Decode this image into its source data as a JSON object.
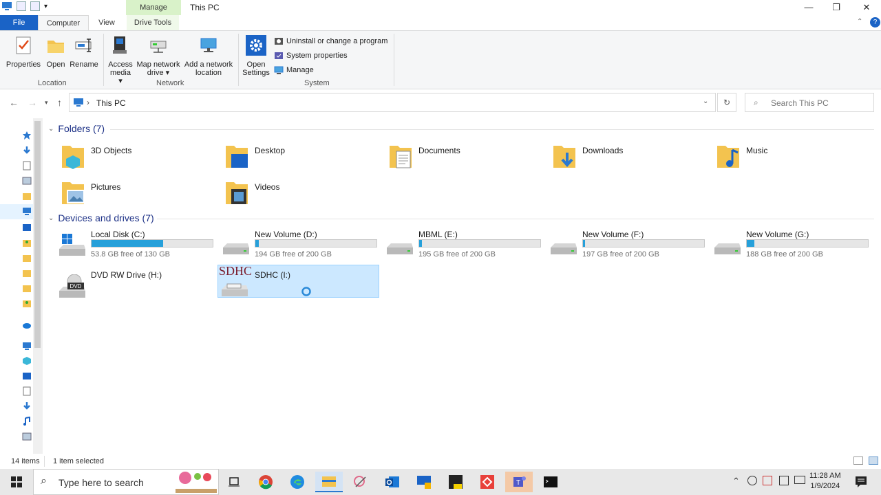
{
  "window": {
    "title": "This PC",
    "context_tab": "Manage",
    "controls": {
      "minimize": "—",
      "maximize": "❐",
      "close": "✕"
    }
  },
  "ribbon": {
    "tabs": [
      "File",
      "Computer",
      "View",
      "Drive Tools"
    ],
    "location_group": {
      "label": "Location",
      "buttons": [
        "Properties",
        "Open",
        "Rename"
      ]
    },
    "network_group": {
      "label": "Network",
      "access_media": [
        "Access",
        "media ▾"
      ],
      "map_network": [
        "Map network",
        "drive ▾"
      ],
      "add_network": [
        "Add a network",
        "location"
      ]
    },
    "system_group": {
      "label": "System",
      "open_settings": [
        "Open",
        "Settings"
      ],
      "items": [
        "Uninstall or change a program",
        "System properties",
        "Manage"
      ]
    }
  },
  "address": {
    "path": "This PC",
    "search_placeholder": "Search This PC"
  },
  "folders": {
    "header": "Folders (7)",
    "items": [
      "3D Objects",
      "Desktop",
      "Documents",
      "Downloads",
      "Music",
      "Pictures",
      "Videos"
    ]
  },
  "drives": {
    "header": "Devices and drives (7)",
    "items": [
      {
        "name": "Local Disk (C:)",
        "free": "53.8 GB free of 130 GB",
        "used_pct": 59
      },
      {
        "name": "New Volume (D:)",
        "free": "194 GB free of 200 GB",
        "used_pct": 3
      },
      {
        "name": "MBML (E:)",
        "free": "195 GB free of 200 GB",
        "used_pct": 2.5
      },
      {
        "name": "New Volume (F:)",
        "free": "197 GB free of 200 GB",
        "used_pct": 1.5
      },
      {
        "name": "New Volume (G:)",
        "free": "188 GB free of 200 GB",
        "used_pct": 6
      },
      {
        "name": "DVD RW Drive (H:)"
      },
      {
        "name": "SDHC (I:)",
        "badge": "SDHC"
      }
    ],
    "dvd_badge": "DVD"
  },
  "status": {
    "items": "14 items",
    "selected": "1 item selected"
  },
  "taskbar": {
    "search_placeholder": "Type here to search",
    "time": "11:28 AM",
    "date": "1/9/2024"
  },
  "colors": {
    "accent": "#1a63c6",
    "drive_bar": "#26a0da",
    "selection": "#cce8ff",
    "folder": "#f3c34f"
  }
}
